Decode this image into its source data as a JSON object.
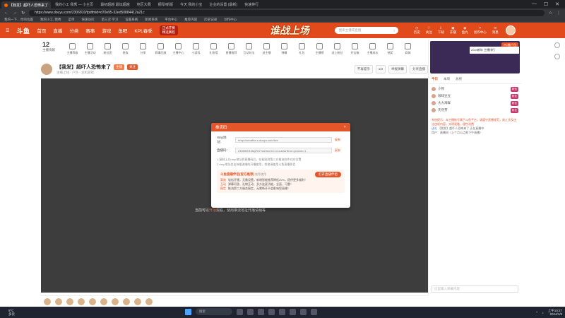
{
  "browser": {
    "tabs": [
      {
        "label": "《超巧主持》精选集(2款)",
        "active": false
      },
      {
        "label": "【我发】超吓人恐怖来了",
        "active": true
      },
      {
        "label": "我的小工 我秀 — 小主页",
        "active": false
      },
      {
        "label": "最初超越 最炫超越",
        "active": false
      },
      {
        "label": "地区大赛",
        "active": false
      },
      {
        "label": "钢琴/新版",
        "active": false
      },
      {
        "label": "今天 我的小宝",
        "active": false
      },
      {
        "label": "企业的设置 (最新)",
        "active": false
      },
      {
        "label": "快速排行",
        "active": false
      },
      {
        "label": "创作中心 — 预期模式",
        "active": false
      },
      {
        "label": "最新推荐",
        "active": false
      },
      {
        "label": "查看最新数据",
        "active": false
      },
      {
        "label": "快速导航",
        "active": false
      }
    ],
    "url": "https://www.douyu.com/2306810/tpdfmid=d70e95-32ed50884412a21c",
    "bookmarks": [
      "我的一下... 你的位置",
      "我的小工, 我秀",
      "菜单",
      "快速访问",
      "第三次 学习",
      "设置系统",
      "新闻系统",
      "平台中心",
      "推荐内容",
      "历史记录",
      "创作中心",
      "最新推荐",
      "在线工具"
    ]
  },
  "header": {
    "logo": "斗鱼",
    "nav": [
      "首页",
      "直播",
      "分类",
      "赛事",
      "游戏",
      "鱼吧",
      "KPL春季"
    ],
    "event_top": "正式开赛",
    "event_bottom": "精选赛程",
    "banner": "谁战上场",
    "search_placeholder": "搜索主播或直播",
    "icons": [
      "历史",
      "关注",
      "下载",
      "开播",
      "鱼丸",
      "创作中心",
      "消息"
    ]
  },
  "fans": {
    "count": "12",
    "label": "主播贡献"
  },
  "tools": [
    "主播等级",
    "主播活动",
    "粉丝团",
    "贵族",
    "分享",
    "赛事回放",
    "主播中心",
    "小游戏",
    "礼物墙",
    "直播推荐",
    "互动玩法",
    "送主播",
    "弹幕",
    "礼包",
    "主播榜",
    "送上粉丝",
    "开宝箱",
    "主播成长",
    "抽奖",
    "商城",
    "设置"
  ],
  "room": {
    "title": "【我发】超吓人恐怖来了",
    "tag": "主播",
    "badge": "关注",
    "sub": "主播上线 · 户外 · 主机游戏",
    "buttons": [
      "不再提示",
      "1/3",
      "举报弹幕",
      "分享直播"
    ]
  },
  "player": {
    "msg_prefix": "当前可以",
    "msg_highlight": "开播",
    "msg_suffix": "观看，使用推流地址开播请稍等"
  },
  "modal": {
    "title": "推流码",
    "close": "×",
    "rtmp_label": "rtmp地址：",
    "rtmp_value": "rtmp://sendfhe-s.douyu.com/live",
    "stream_label": "直播码：",
    "stream_value": "230690010ktyRG?wsSecret=••••••&wsTime=ynamic=1",
    "copy": "复制",
    "note1": "1.复制上方rtmp地址到直播码后，在粘贴到第三方推流软件对应位置",
    "note2": "2.rtmp地址仅支持推流端的开播使用，其他请使用斗鱼直播伴侣",
    "promo_title": "斗鱼直播伴侣(官方推荐)",
    "promo_sub": "推荐使用",
    "open_button": "打开直播伴侣",
    "lines": [
      {
        "tag": "高效",
        "text": "轻松开播，无需设置，新增智能推荐降低20%，提供更多福利！"
      },
      {
        "tag": "互动",
        "text": "弹幕问答、礼物互动、多方连麦功能，全面、可靠！"
      },
      {
        "tag": "稳定",
        "text": "推流第二方服务稳定，无需断开不会影响您直播！"
      }
    ]
  },
  "rightcol": {
    "hero_tag": "PC推广位",
    "hero_info": "2024新年 主播排行",
    "rank_tabs": [
      "今日",
      "本周",
      "总榜"
    ],
    "rank_items": [
      {
        "name": "小熊",
        "badge": "粉丝"
      },
      {
        "name": "咖啡豆豆",
        "badge": "粉丝"
      },
      {
        "name": "大大海鲜",
        "badge": "粉丝"
      },
      {
        "name": "天然茶",
        "badge": "粉丝"
      }
    ],
    "chat_system": "系统提示：本主播账号属于斗鱼平台，请遵守直播规范，禁止涉及违法违规内容，文明观看，理性消费",
    "chat_nick": "送礼",
    "chat_text": "【我发】超吓人恐怖来了 正在直播中",
    "chat_extra": "用户：直播间（上个月11点到下午直播）",
    "chat_input_placeholder": "这里输入弹幕内容"
  },
  "taskbar": {
    "temp": "9°C",
    "weather": "多云",
    "search": "搜索",
    "time": "上午10:27",
    "date": "2024/1/8"
  }
}
